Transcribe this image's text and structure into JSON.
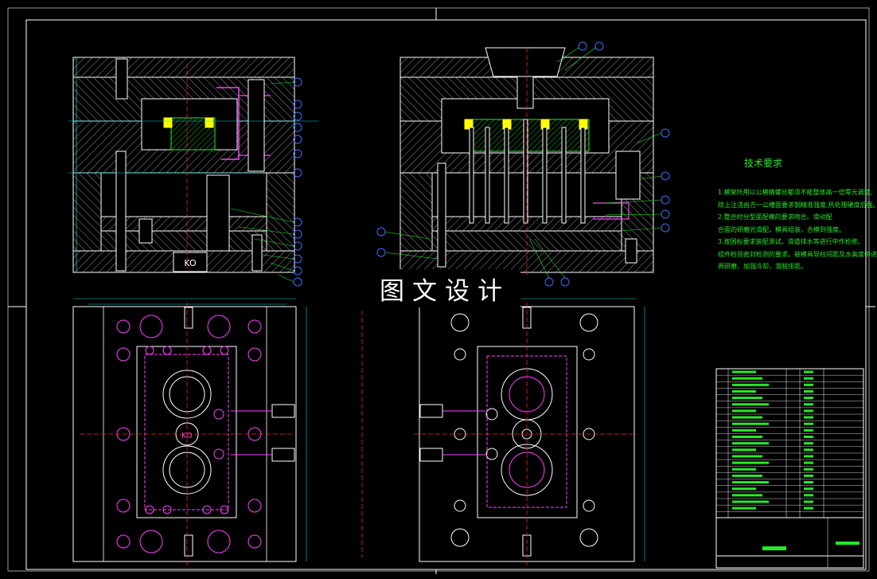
{
  "watermark": "图文设计",
  "section_labels": {
    "cavity_block": "KO",
    "bottom_plate": "KO",
    "plan_center": "KO"
  },
  "technical_requirements": {
    "title": "技术要求",
    "lines": [
      "1.模架所用以公模精螺丝都须不能整体高一倍零元调整,",
      "除上注浇由方一公槽面要求钢精准强度,热处理硬度后强。",
      "2.整合时分型面配模的要求吻合。滑动配",
      "合面的研磨光滑配，模具组装，合模到强度。",
      "3.按国标要求装配测试。滑道排水等进行中作检修。",
      "组件检验密封检测的要求。被模具导柱间距及水高度中进行",
      "再研磨，加强冷却，滑脱排距。"
    ]
  },
  "colors": {
    "background": "#000000",
    "outline": "#ffffff",
    "center_line": "#ff2020",
    "cooling": "#ff40ff",
    "balloon": "#3b6cff",
    "dimension": "#00d8d8",
    "annotation": "#27e827",
    "insert": "#ffff00"
  }
}
